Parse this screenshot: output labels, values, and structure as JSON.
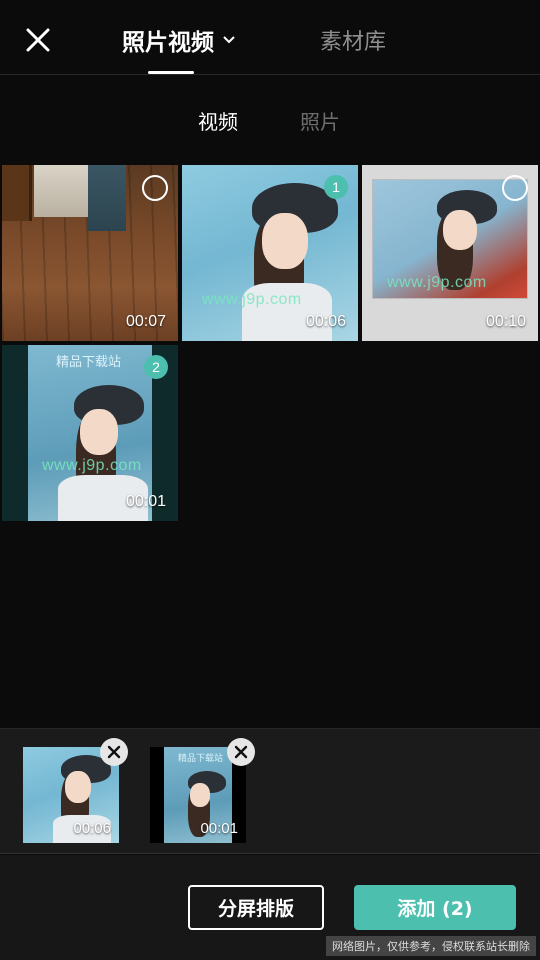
{
  "header": {
    "close_icon": "close-icon",
    "tab_main_label": "照片视频",
    "tab_main_icon": "chevron-down-icon",
    "tab_library_label": "素材库"
  },
  "subtabs": {
    "video_label": "视频",
    "photo_label": "照片"
  },
  "grid": [
    {
      "duration": "00:07",
      "selection": ""
    },
    {
      "duration": "00:06",
      "selection": "1",
      "watermark": "www.j9p.com"
    },
    {
      "duration": "00:10",
      "selection": "",
      "watermark": "www.j9p.com"
    },
    {
      "duration": "00:01",
      "selection": "2",
      "watermark": "www.j9p.com",
      "top_text": "精品下载站"
    }
  ],
  "tray": [
    {
      "duration": "00:06"
    },
    {
      "duration": "00:01",
      "top_text": "精品下载站"
    }
  ],
  "bottom": {
    "split_label": "分屏排版",
    "add_label": "添加 (2)",
    "footer_note": "网络图片，仅供参考，侵权联系站长删除"
  },
  "colors": {
    "accent": "#4cbfae",
    "background": "#0b0b0b",
    "tray_background": "#1b1b1b"
  }
}
